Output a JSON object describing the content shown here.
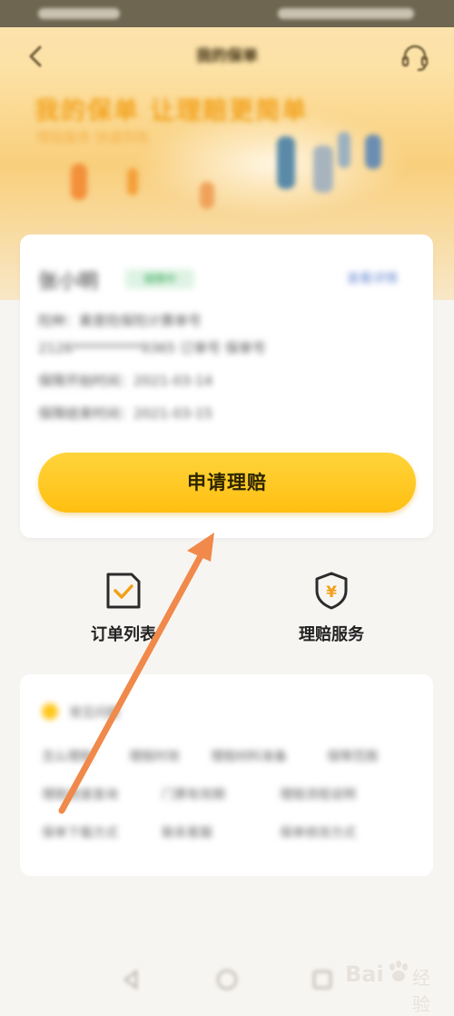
{
  "navbar": {
    "title": "我的保单"
  },
  "banner": {
    "headline": "我的保单 让理赔更简单",
    "subline": "理赔服务 快速到账"
  },
  "policy_card": {
    "holder_name": "张小明",
    "status_badge": "保障中",
    "detail_link": "查看详情",
    "line_policy": "险种：乘意险保险计算单号",
    "line_number": "2126**********9365 订单号 保单号",
    "line_start": "保障开始时间：2021-03-14",
    "line_end": "保障结束时间：2021-03-15",
    "claim_button": "申请理赔"
  },
  "shortcuts": [
    {
      "label": "订单列表",
      "icon": "order-check-icon"
    },
    {
      "label": "理赔服务",
      "icon": "yen-shield-icon"
    }
  ],
  "faq": {
    "title": "常见问题",
    "tags": [
      "怎么理赔",
      "理赔时效",
      "理赔材料准备",
      "保障范围",
      "理赔进度查询",
      "门票有效期",
      "理赔流程说明",
      "保单下载方式",
      "联系客服",
      "保单修改方式"
    ]
  },
  "watermark": {
    "brand": "Bai",
    "sub": "经验"
  },
  "colors": {
    "accent": "#ffc21a",
    "arrow": "#f0894a",
    "icon_outline": "#2b2b2b",
    "icon_check": "#f2a01a"
  }
}
